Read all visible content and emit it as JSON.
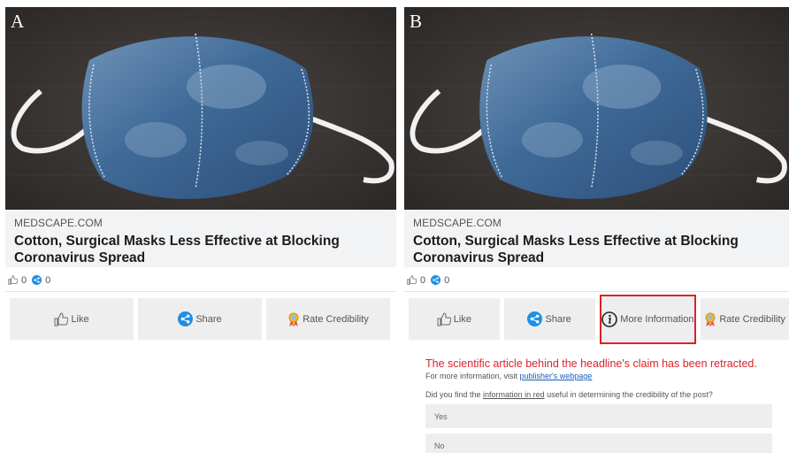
{
  "panels": {
    "a": {
      "letter": "A"
    },
    "b": {
      "letter": "B"
    }
  },
  "post": {
    "source": "MEDSCAPE.COM",
    "headline": "Cotton, Surgical Masks Less Effective at Blocking Coronavirus Spread",
    "likes_count": "0",
    "shares_count": "0"
  },
  "actions": {
    "like": "Like",
    "share": "Share",
    "rate": "Rate Credibility",
    "more_info": "More Information"
  },
  "retraction": {
    "message": "The scientific article behind the headline's claim has been retracted.",
    "sub_prefix": "For more information, visit ",
    "sub_link": "publisher's webpage",
    "question_prefix": "Did you find the ",
    "question_underlined": "information in red",
    "question_suffix": " useful in determining the credibility of the post?",
    "options": [
      "Yes",
      "No"
    ]
  },
  "colors": {
    "highlight": "#d9232a",
    "share_blue": "#1f8fe6",
    "link": "#1a5fb4"
  },
  "icons": {
    "like": "thumbs-up-icon",
    "share": "share-icon",
    "rate": "award-ribbon-icon",
    "more_info": "info-circle-icon"
  }
}
